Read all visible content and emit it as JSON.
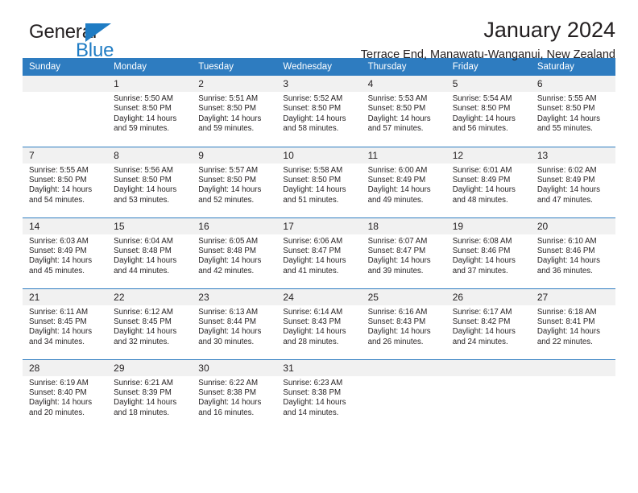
{
  "logo": {
    "word1": "General",
    "word2": "Blue",
    "triangle_color": "#1F7CC4"
  },
  "header": {
    "title": "January 2024",
    "subtitle": "Terrace End, Manawatu-Wanganui, New Zealand"
  },
  "theme": {
    "header_blue": "#2E7CC0",
    "daynum_gray": "#F1F1F1",
    "text": "#231f20"
  },
  "weekday_headers": [
    "Sunday",
    "Monday",
    "Tuesday",
    "Wednesday",
    "Thursday",
    "Friday",
    "Saturday"
  ],
  "weeks": [
    [
      {
        "day": "",
        "sunrise": "",
        "sunset": "",
        "daylight": "",
        "daylight2": ""
      },
      {
        "day": "1",
        "sunrise": "Sunrise: 5:50 AM",
        "sunset": "Sunset: 8:50 PM",
        "daylight": "Daylight: 14 hours",
        "daylight2": "and 59 minutes."
      },
      {
        "day": "2",
        "sunrise": "Sunrise: 5:51 AM",
        "sunset": "Sunset: 8:50 PM",
        "daylight": "Daylight: 14 hours",
        "daylight2": "and 59 minutes."
      },
      {
        "day": "3",
        "sunrise": "Sunrise: 5:52 AM",
        "sunset": "Sunset: 8:50 PM",
        "daylight": "Daylight: 14 hours",
        "daylight2": "and 58 minutes."
      },
      {
        "day": "4",
        "sunrise": "Sunrise: 5:53 AM",
        "sunset": "Sunset: 8:50 PM",
        "daylight": "Daylight: 14 hours",
        "daylight2": "and 57 minutes."
      },
      {
        "day": "5",
        "sunrise": "Sunrise: 5:54 AM",
        "sunset": "Sunset: 8:50 PM",
        "daylight": "Daylight: 14 hours",
        "daylight2": "and 56 minutes."
      },
      {
        "day": "6",
        "sunrise": "Sunrise: 5:55 AM",
        "sunset": "Sunset: 8:50 PM",
        "daylight": "Daylight: 14 hours",
        "daylight2": "and 55 minutes."
      }
    ],
    [
      {
        "day": "7",
        "sunrise": "Sunrise: 5:55 AM",
        "sunset": "Sunset: 8:50 PM",
        "daylight": "Daylight: 14 hours",
        "daylight2": "and 54 minutes."
      },
      {
        "day": "8",
        "sunrise": "Sunrise: 5:56 AM",
        "sunset": "Sunset: 8:50 PM",
        "daylight": "Daylight: 14 hours",
        "daylight2": "and 53 minutes."
      },
      {
        "day": "9",
        "sunrise": "Sunrise: 5:57 AM",
        "sunset": "Sunset: 8:50 PM",
        "daylight": "Daylight: 14 hours",
        "daylight2": "and 52 minutes."
      },
      {
        "day": "10",
        "sunrise": "Sunrise: 5:58 AM",
        "sunset": "Sunset: 8:50 PM",
        "daylight": "Daylight: 14 hours",
        "daylight2": "and 51 minutes."
      },
      {
        "day": "11",
        "sunrise": "Sunrise: 6:00 AM",
        "sunset": "Sunset: 8:49 PM",
        "daylight": "Daylight: 14 hours",
        "daylight2": "and 49 minutes."
      },
      {
        "day": "12",
        "sunrise": "Sunrise: 6:01 AM",
        "sunset": "Sunset: 8:49 PM",
        "daylight": "Daylight: 14 hours",
        "daylight2": "and 48 minutes."
      },
      {
        "day": "13",
        "sunrise": "Sunrise: 6:02 AM",
        "sunset": "Sunset: 8:49 PM",
        "daylight": "Daylight: 14 hours",
        "daylight2": "and 47 minutes."
      }
    ],
    [
      {
        "day": "14",
        "sunrise": "Sunrise: 6:03 AM",
        "sunset": "Sunset: 8:49 PM",
        "daylight": "Daylight: 14 hours",
        "daylight2": "and 45 minutes."
      },
      {
        "day": "15",
        "sunrise": "Sunrise: 6:04 AM",
        "sunset": "Sunset: 8:48 PM",
        "daylight": "Daylight: 14 hours",
        "daylight2": "and 44 minutes."
      },
      {
        "day": "16",
        "sunrise": "Sunrise: 6:05 AM",
        "sunset": "Sunset: 8:48 PM",
        "daylight": "Daylight: 14 hours",
        "daylight2": "and 42 minutes."
      },
      {
        "day": "17",
        "sunrise": "Sunrise: 6:06 AM",
        "sunset": "Sunset: 8:47 PM",
        "daylight": "Daylight: 14 hours",
        "daylight2": "and 41 minutes."
      },
      {
        "day": "18",
        "sunrise": "Sunrise: 6:07 AM",
        "sunset": "Sunset: 8:47 PM",
        "daylight": "Daylight: 14 hours",
        "daylight2": "and 39 minutes."
      },
      {
        "day": "19",
        "sunrise": "Sunrise: 6:08 AM",
        "sunset": "Sunset: 8:46 PM",
        "daylight": "Daylight: 14 hours",
        "daylight2": "and 37 minutes."
      },
      {
        "day": "20",
        "sunrise": "Sunrise: 6:10 AM",
        "sunset": "Sunset: 8:46 PM",
        "daylight": "Daylight: 14 hours",
        "daylight2": "and 36 minutes."
      }
    ],
    [
      {
        "day": "21",
        "sunrise": "Sunrise: 6:11 AM",
        "sunset": "Sunset: 8:45 PM",
        "daylight": "Daylight: 14 hours",
        "daylight2": "and 34 minutes."
      },
      {
        "day": "22",
        "sunrise": "Sunrise: 6:12 AM",
        "sunset": "Sunset: 8:45 PM",
        "daylight": "Daylight: 14 hours",
        "daylight2": "and 32 minutes."
      },
      {
        "day": "23",
        "sunrise": "Sunrise: 6:13 AM",
        "sunset": "Sunset: 8:44 PM",
        "daylight": "Daylight: 14 hours",
        "daylight2": "and 30 minutes."
      },
      {
        "day": "24",
        "sunrise": "Sunrise: 6:14 AM",
        "sunset": "Sunset: 8:43 PM",
        "daylight": "Daylight: 14 hours",
        "daylight2": "and 28 minutes."
      },
      {
        "day": "25",
        "sunrise": "Sunrise: 6:16 AM",
        "sunset": "Sunset: 8:43 PM",
        "daylight": "Daylight: 14 hours",
        "daylight2": "and 26 minutes."
      },
      {
        "day": "26",
        "sunrise": "Sunrise: 6:17 AM",
        "sunset": "Sunset: 8:42 PM",
        "daylight": "Daylight: 14 hours",
        "daylight2": "and 24 minutes."
      },
      {
        "day": "27",
        "sunrise": "Sunrise: 6:18 AM",
        "sunset": "Sunset: 8:41 PM",
        "daylight": "Daylight: 14 hours",
        "daylight2": "and 22 minutes."
      }
    ],
    [
      {
        "day": "28",
        "sunrise": "Sunrise: 6:19 AM",
        "sunset": "Sunset: 8:40 PM",
        "daylight": "Daylight: 14 hours",
        "daylight2": "and 20 minutes."
      },
      {
        "day": "29",
        "sunrise": "Sunrise: 6:21 AM",
        "sunset": "Sunset: 8:39 PM",
        "daylight": "Daylight: 14 hours",
        "daylight2": "and 18 minutes."
      },
      {
        "day": "30",
        "sunrise": "Sunrise: 6:22 AM",
        "sunset": "Sunset: 8:38 PM",
        "daylight": "Daylight: 14 hours",
        "daylight2": "and 16 minutes."
      },
      {
        "day": "31",
        "sunrise": "Sunrise: 6:23 AM",
        "sunset": "Sunset: 8:38 PM",
        "daylight": "Daylight: 14 hours",
        "daylight2": "and 14 minutes."
      },
      {
        "day": "",
        "sunrise": "",
        "sunset": "",
        "daylight": "",
        "daylight2": ""
      },
      {
        "day": "",
        "sunrise": "",
        "sunset": "",
        "daylight": "",
        "daylight2": ""
      },
      {
        "day": "",
        "sunrise": "",
        "sunset": "",
        "daylight": "",
        "daylight2": ""
      }
    ]
  ]
}
